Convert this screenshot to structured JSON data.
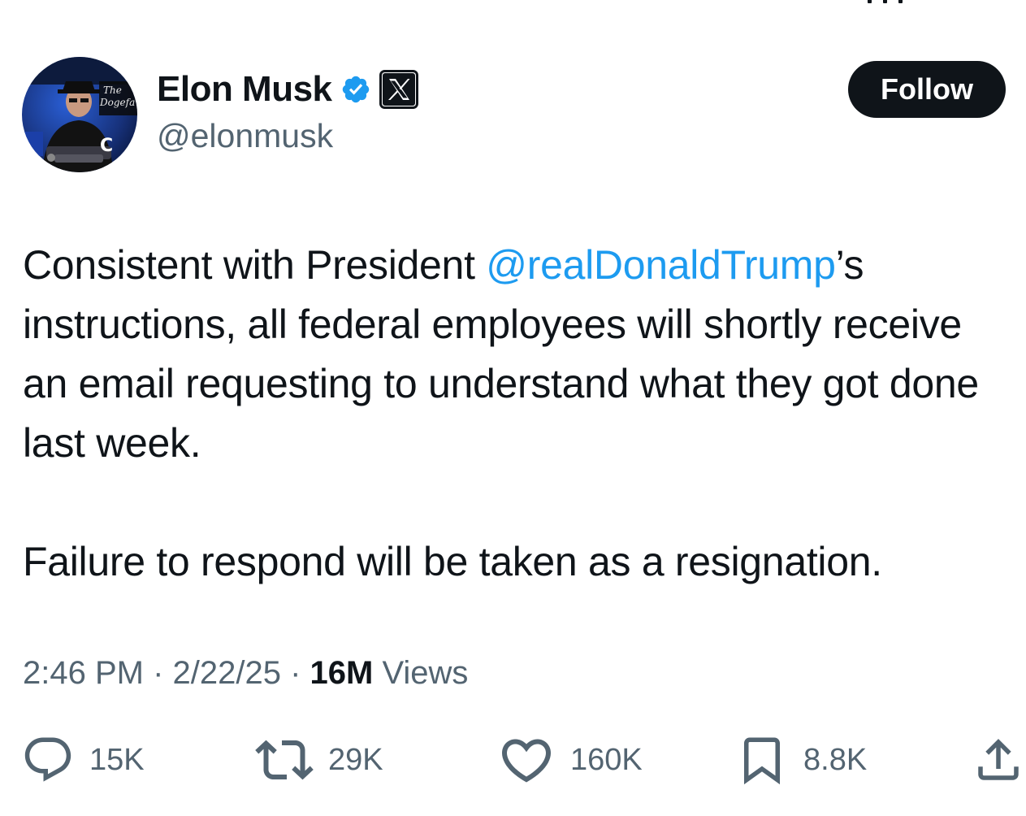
{
  "author": {
    "display_name": "Elon Musk",
    "handle": "@elonmusk",
    "verified_badge_icon": "verified-badge-icon",
    "affiliate_icon": "x-logo-icon",
    "avatar_overlay_text": "The Dogefa",
    "avatar_corner_text": "C"
  },
  "follow_button": {
    "label": "Follow"
  },
  "tweet": {
    "text_before_mention": "Consistent with President ",
    "mention": "@realDonaldTrump",
    "text_after_mention": "’s instructions, all federal employees will shortly receive an email requesting to understand what they got done last week.",
    "paragraph_2": "Failure to respond will be taken as a resignation."
  },
  "meta": {
    "time": "2:46 PM",
    "separator": " · ",
    "date": "2/22/25",
    "views_count": "16M",
    "views_label": " Views"
  },
  "actions": {
    "replies": "15K",
    "reposts": "29K",
    "likes": "160K",
    "bookmarks": "8.8K"
  },
  "colors": {
    "text_primary": "#0f1419",
    "text_secondary": "#536471",
    "accent_blue": "#1d9bf0",
    "follow_bg": "#0f1419"
  }
}
